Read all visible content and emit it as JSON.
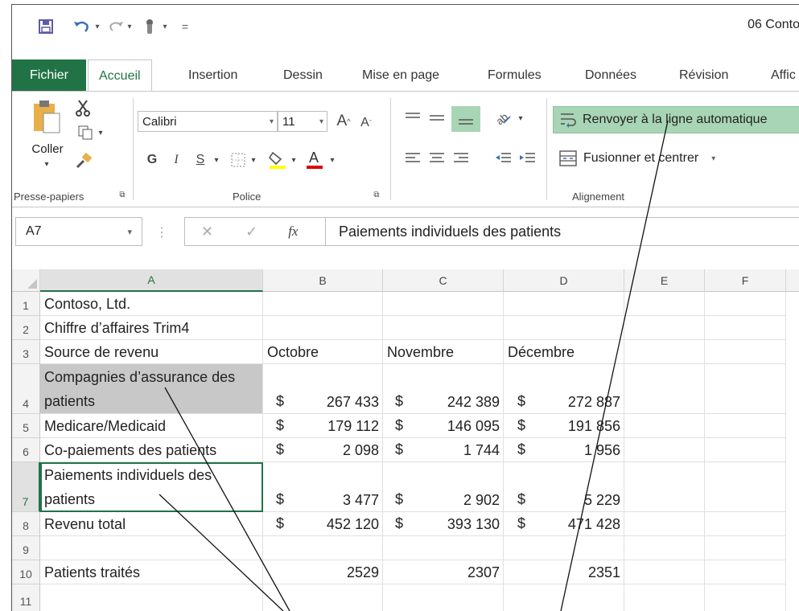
{
  "window": {
    "title": "06 Conto"
  },
  "qat": {
    "save_icon": "save-icon",
    "undo_icon": "undo-icon",
    "redo_icon": "redo-icon",
    "touch_icon": "touch-mode-icon",
    "customize": "="
  },
  "tabs": [
    "Fichier",
    "Accueil",
    "Insertion",
    "Dessin",
    "Mise en page",
    "Formules",
    "Données",
    "Révision",
    "Affic"
  ],
  "ribbon": {
    "clipboard": {
      "paste_label": "Coller",
      "group_label": "Presse-papiers"
    },
    "font": {
      "name": "Calibri",
      "size": "11",
      "bold": "G",
      "italic": "I",
      "underline": "S",
      "group_label": "Police"
    },
    "alignment": {
      "wrap_label": "Renvoyer à la ligne automatique",
      "merge_label": "Fusionner et centrer",
      "group_label": "Alignement"
    }
  },
  "formula_bar": {
    "name_box": "A7",
    "cancel": "✕",
    "enter": "✓",
    "fx": "fx",
    "content": "Paiements individuels des patients"
  },
  "columns": [
    "A",
    "B",
    "C",
    "D",
    "E",
    "F"
  ],
  "rows": [
    "1",
    "2",
    "3",
    "4",
    "5",
    "6",
    "7",
    "8",
    "9",
    "10",
    "11"
  ],
  "sheet": {
    "r1": {
      "a": "Contoso, Ltd."
    },
    "r2": {
      "a": "Chiffre d’affaires Trim4"
    },
    "r3": {
      "a": "Source de revenu",
      "b": "Octobre",
      "c": "Novembre",
      "d": "Décembre"
    },
    "r4": {
      "a": "Compagnies d’assurance des patients",
      "b": "267 433",
      "c": "242 389",
      "d": "272 887"
    },
    "r5": {
      "a": "Medicare/Medicaid",
      "b": "179 112",
      "c": "146 095",
      "d": "191 856"
    },
    "r6": {
      "a": "Co-paiements des patients",
      "b": "2 098",
      "c": "1 744",
      "d": "1 956"
    },
    "r7": {
      "a": "Paiements individuels des patients",
      "b": "3 477",
      "c": "2 902",
      "d": "5 229"
    },
    "r8": {
      "a": "Revenu total",
      "b": "452 120",
      "c": "393 130",
      "d": "471 428"
    },
    "r10": {
      "a": "Patients traités",
      "b": "2529",
      "c": "2307",
      "d": "2351"
    },
    "currency": "$"
  }
}
